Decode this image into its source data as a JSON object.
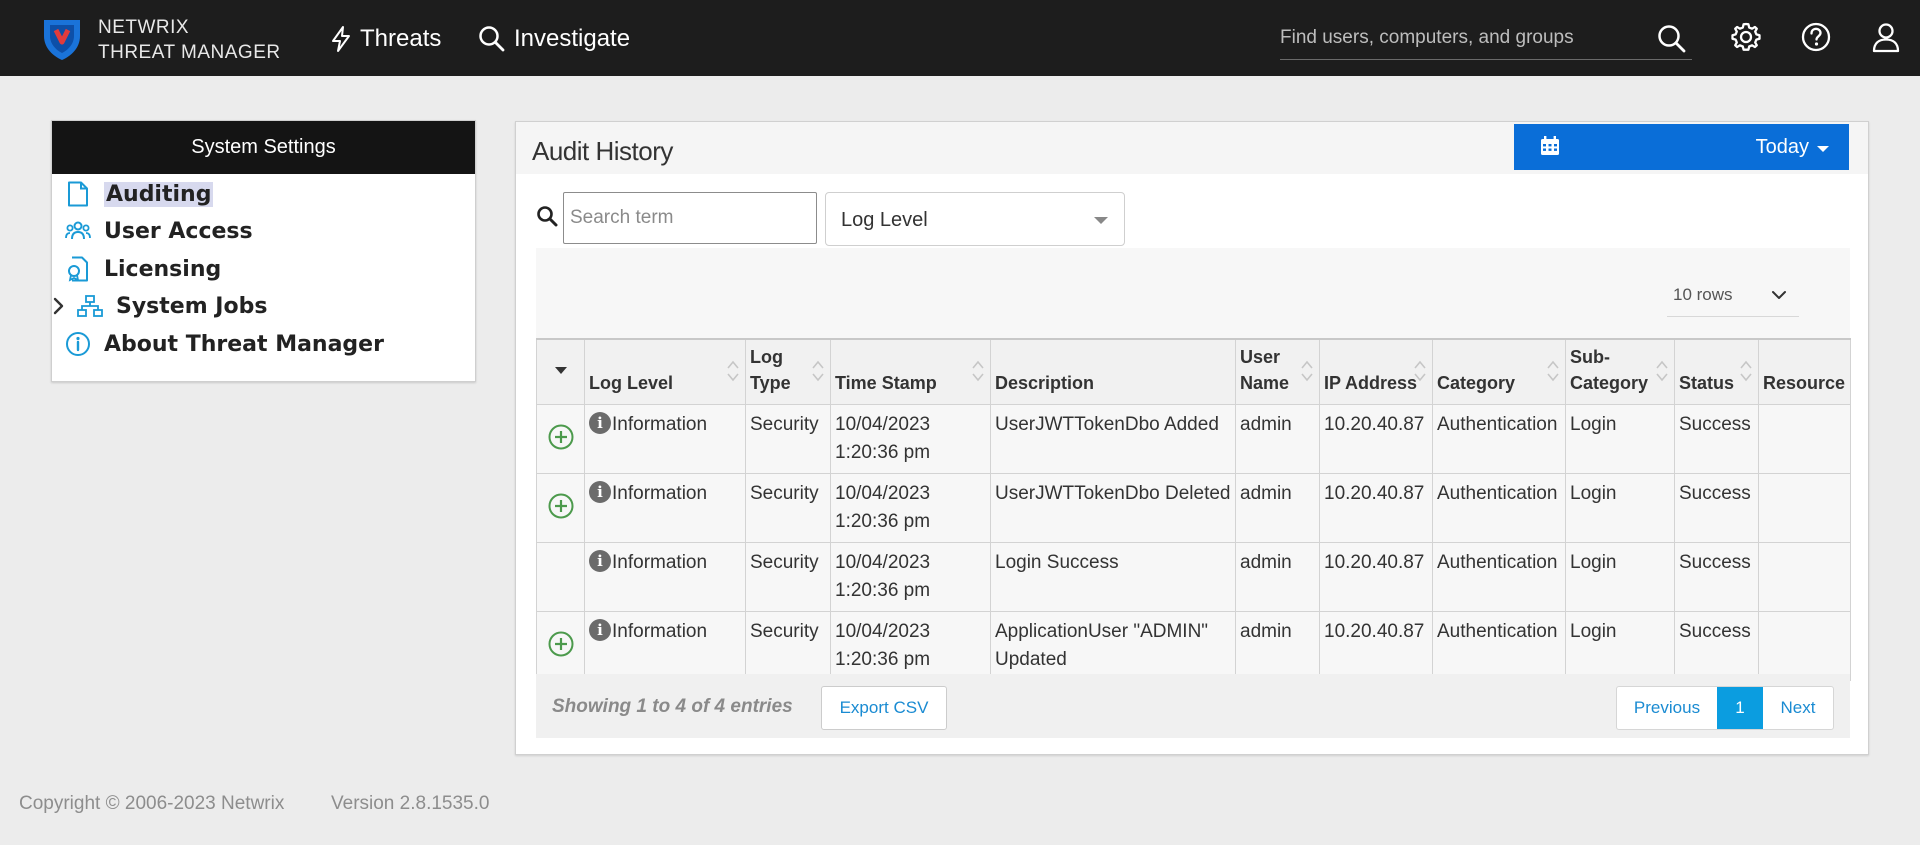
{
  "brand": {
    "line1": "NETWRIX",
    "line2": "THREAT MANAGER"
  },
  "nav": {
    "threats": "Threats",
    "investigate": "Investigate"
  },
  "top_search": {
    "placeholder": "Find users, computers, and groups"
  },
  "sidebar": {
    "title": "System Settings",
    "items": [
      {
        "label": "Auditing",
        "icon": "file-icon"
      },
      {
        "label": "User Access",
        "icon": "users-icon"
      },
      {
        "label": "Licensing",
        "icon": "license-icon"
      },
      {
        "label": "System Jobs",
        "icon": "sitemap-icon"
      },
      {
        "label": "About Threat Manager",
        "icon": "info-icon"
      }
    ]
  },
  "panel": {
    "title": "Audit History",
    "date_filter": "Today",
    "search_placeholder": "Search term",
    "log_level_filter": "Log Level",
    "rows_per_page": "10 rows"
  },
  "table": {
    "headers": {
      "log_level": "Log Level",
      "log_type": "Log Type",
      "time_stamp": "Time Stamp",
      "description": "Description",
      "user_name": "User Name",
      "ip_address": "IP Address",
      "category": "Category",
      "sub_category": "Sub-Category",
      "status": "Status",
      "resource": "Resource"
    },
    "rows": [
      {
        "expand": true,
        "log_level": "Information",
        "log_type": "Security",
        "date": "10/04/2023",
        "time": "1:20:36 pm",
        "description": "UserJWTTokenDbo Added",
        "user_name": "admin",
        "ip_address": "10.20.40.87",
        "category": "Authentication",
        "sub_category": "Login",
        "status": "Success",
        "resource": ""
      },
      {
        "expand": true,
        "log_level": "Information",
        "log_type": "Security",
        "date": "10/04/2023",
        "time": "1:20:36 pm",
        "description": "UserJWTTokenDbo Deleted",
        "user_name": "admin",
        "ip_address": "10.20.40.87",
        "category": "Authentication",
        "sub_category": "Login",
        "status": "Success",
        "resource": ""
      },
      {
        "expand": false,
        "log_level": "Information",
        "log_type": "Security",
        "date": "10/04/2023",
        "time": "1:20:36 pm",
        "description": "Login Success",
        "user_name": "admin",
        "ip_address": "10.20.40.87",
        "category": "Authentication",
        "sub_category": "Login",
        "status": "Success",
        "resource": ""
      },
      {
        "expand": true,
        "log_level": "Information",
        "log_type": "Security",
        "date": "10/04/2023",
        "time": "1:20:36 pm",
        "description": "ApplicationUser \"ADMIN\" Updated",
        "user_name": "admin",
        "ip_address": "10.20.40.87",
        "category": "Authentication",
        "sub_category": "Login",
        "status": "Success",
        "resource": ""
      }
    ]
  },
  "table_footer": {
    "showing": "Showing 1 to 4 of 4 entries",
    "export": "Export CSV",
    "previous": "Previous",
    "current_page": "1",
    "next": "Next"
  },
  "footer": {
    "copyright": "Copyright © 2006-2023 Netwrix",
    "version": "Version 2.8.1535.0"
  },
  "colors": {
    "accent": "#0a6ed8",
    "topbar": "#1d1d1d",
    "link": "#1a8bd2",
    "expand_icon": "#4c9a4c"
  }
}
